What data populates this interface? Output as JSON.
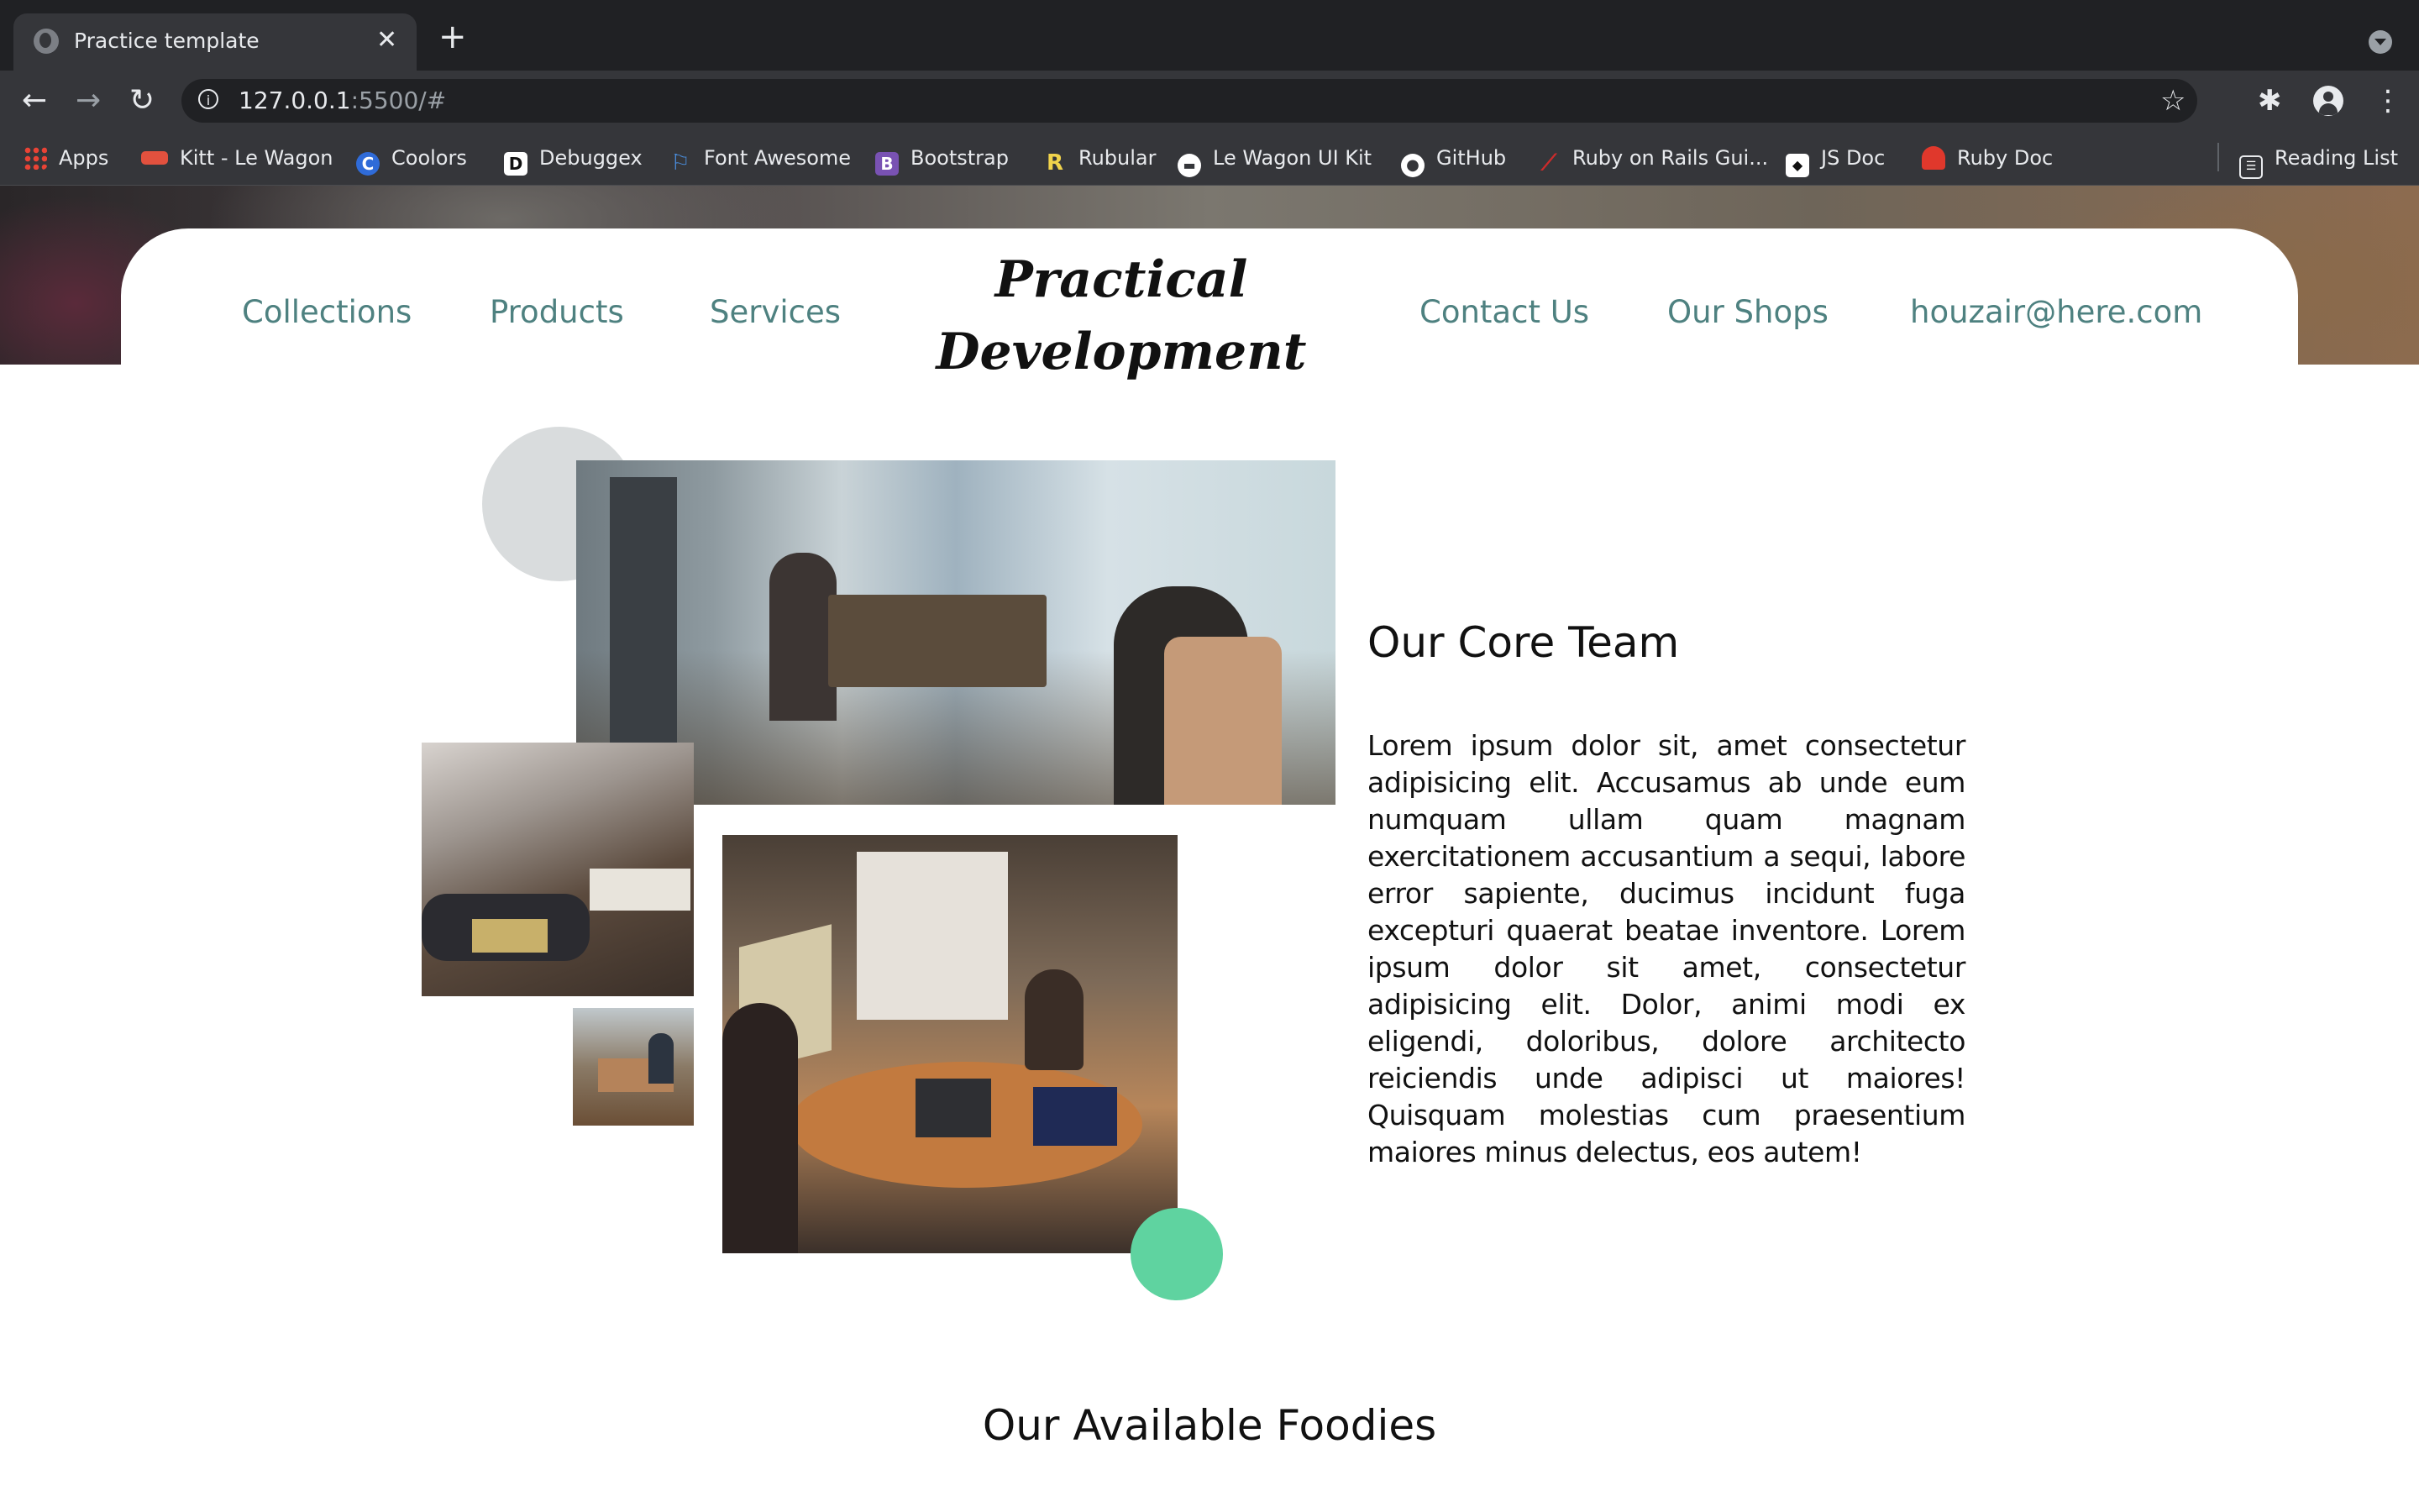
{
  "browser": {
    "tab": {
      "title": "Practice template",
      "close_icon": "close-icon"
    },
    "new_tab_symbol": "+",
    "url": {
      "host": "127.0.0.1",
      "rest": ":5500/#"
    },
    "bookmarks": [
      {
        "label": "Apps",
        "icon": "apps-grid-icon",
        "color": "#ea4335"
      },
      {
        "label": "Kitt - Le Wagon",
        "icon": "le-wagon-icon",
        "color": "#e2513e"
      },
      {
        "label": "Coolors",
        "icon": "coolors-icon",
        "color": "#2f6bd8"
      },
      {
        "label": "Debuggex",
        "icon": "debuggex-icon",
        "color": "#ffffff"
      },
      {
        "label": "Font Awesome",
        "icon": "flag-icon",
        "color": "#4a8fe0"
      },
      {
        "label": "Bootstrap",
        "icon": "bootstrap-icon",
        "color": "#7952b3"
      },
      {
        "label": "Rubular",
        "icon": "rubular-icon",
        "color": "#f1d34b"
      },
      {
        "label": "Le Wagon UI Kit",
        "icon": "le-wagon-ui-kit-icon",
        "color": "#ffffff"
      },
      {
        "label": "GitHub",
        "icon": "github-icon",
        "color": "#ffffff"
      },
      {
        "label": "Ruby on Rails Gui...",
        "icon": "rails-icon",
        "color": "#cc2b2b"
      },
      {
        "label": "JS Doc",
        "icon": "js-doc-icon",
        "color": "#ffffff"
      },
      {
        "label": "Ruby Doc",
        "icon": "ruby-doc-icon",
        "color": "#e0382c"
      }
    ],
    "reading_list": "Reading List"
  },
  "nav": {
    "left_links": [
      "Collections",
      "Products",
      "Services"
    ],
    "brand_line1": "Practical",
    "brand_line2": "Development",
    "right_links": [
      "Contact Us",
      "Our Shops",
      "houzair@here.com"
    ],
    "link_color": "#4e8180"
  },
  "team": {
    "title": "Our Core Team",
    "body": "Lorem ipsum dolor sit, amet consectetur adipisicing elit. Accusamus ab unde eum numquam ullam quam magnam exercitationem accusantium a sequi, labore error sapiente, ducimus incidunt fuga excepturi quaerat beatae inventore. Lorem ipsum dolor sit amet, consectetur adipisicing elit. Dolor, animi modi ex eligendi, doloribus, dolore architecto reiciendis unde adipisci ut maiores! Quisquam molestias cum praesentium maiores minus delectus, eos autem!",
    "accent_green": "#5fd3a0",
    "accent_grey": "#d9dcdd"
  },
  "foodies": {
    "title": "Our Available Foodies"
  }
}
